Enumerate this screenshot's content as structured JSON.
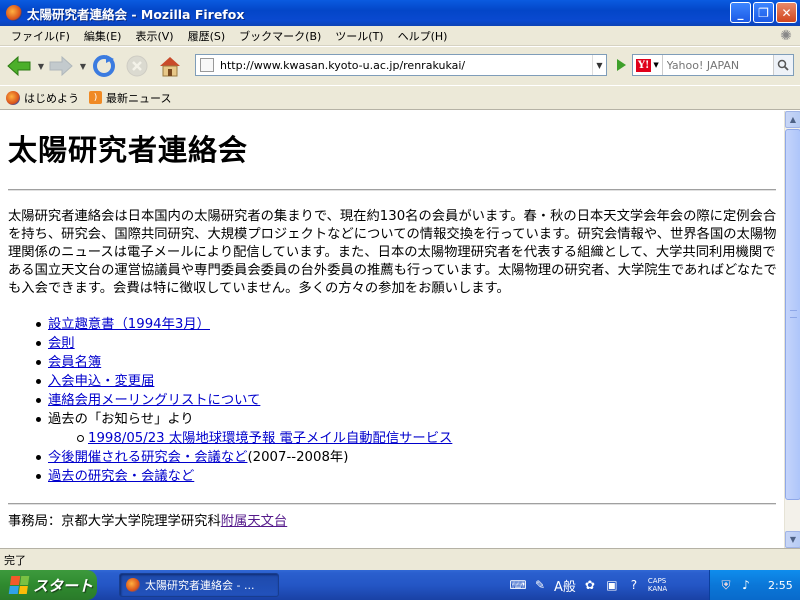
{
  "window": {
    "title": "太陽研究者連絡会 - Mozilla Firefox",
    "controls": [
      "minimize",
      "restore",
      "close"
    ]
  },
  "menubar": {
    "items": [
      "ファイル(F)",
      "編集(E)",
      "表示(V)",
      "履歴(S)",
      "ブックマーク(B)",
      "ツール(T)",
      "ヘルプ(H)"
    ]
  },
  "toolbar": {
    "url": "http://www.kwasan.kyoto-u.ac.jp/renrakukai/",
    "search_placeholder": "Yahoo! JAPAN",
    "search_engine": "Y!"
  },
  "bookmarks": {
    "items": [
      {
        "label": "はじめよう",
        "icon": "firefox-icon"
      },
      {
        "label": "最新ニュース",
        "icon": "rss-icon"
      }
    ]
  },
  "page": {
    "title": "太陽研究者連絡会",
    "intro": "太陽研究者連絡会は日本国内の太陽研究者の集まりで、現在約130名の会員がいます。春・秋の日本天文学会年会の際に定例会合を持ち、研究会、国際共同研究、大規模プロジェクトなどについての情報交換を行っています。研究会情報や、世界各国の太陽物理関係のニュースは電子メールにより配信しています。また、日本の太陽物理研究者を代表する組織として、大学共同利用機関である国立天文台の運営協議員や専門委員会委員の台外委員の推薦も行っています。太陽物理の研究者、大学院生であればどなたでも入会できます。会費は特に徴収していません。多くの方々の参加をお願いします。",
    "links": [
      {
        "label": "設立趣意書（1994年3月）"
      },
      {
        "label": "会則"
      },
      {
        "label": "会員名簿"
      },
      {
        "label": "入会申込・変更届"
      },
      {
        "label": "連絡会用メーリングリストについて"
      }
    ],
    "past_news_label": "過去の「お知らせ」より",
    "past_news": [
      {
        "label": "1998/05/23 太陽地球環境予報 電子メイル自動配信サービス"
      }
    ],
    "upcoming_link": "今後開催される研究会・会議など",
    "upcoming_suffix": "(2007--2008年)",
    "past_meetings_link": "過去の研究会・会議など",
    "footer_text": "事務局：京都大学大学院理学研究科",
    "footer_link": "附属天文台"
  },
  "statusbar": {
    "text": "完了"
  },
  "taskbar": {
    "start_label": "スタート",
    "task_label": "太陽研究者連絡会 - ...",
    "ime_label": "A般",
    "caps": "CAPS",
    "kana": "KANA",
    "clock": "2:55"
  },
  "colors": {
    "link": "#0000cc",
    "visited_link": "#551a8b",
    "titlebar": "#0a5be0",
    "chrome": "#ece9d8"
  }
}
